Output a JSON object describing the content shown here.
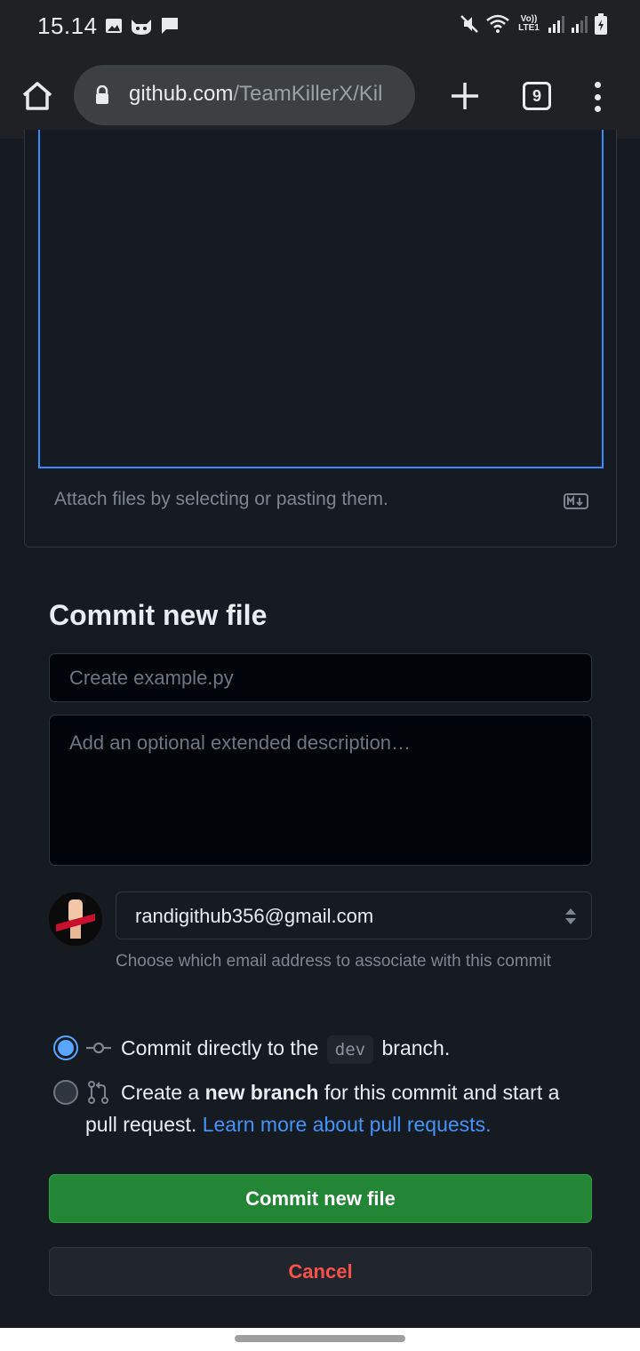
{
  "status_bar": {
    "time": "15.14",
    "lte_label": "Vo)) LTE1",
    "left_icons": [
      "gallery-icon",
      "cat-icon",
      "message-icon"
    ],
    "right_icons": [
      "mute-icon",
      "wifi-icon",
      "signal-icon",
      "signal-icon",
      "battery-icon"
    ]
  },
  "browser": {
    "url_host": "github.com",
    "url_path": "/TeamKillerX/Kil",
    "tab_count": "9"
  },
  "editor": {
    "attach_hint": "Attach files by selecting or pasting them."
  },
  "commit": {
    "title": "Commit new file",
    "summary_placeholder": "Create example.py",
    "description_placeholder": "Add an optional extended description…",
    "email": "randigithub356@gmail.com",
    "email_hint": "Choose which email address to associate with this commit",
    "option_direct_pre": "Commit directly to the",
    "branch": "dev",
    "option_direct_post": "branch.",
    "option_new_pre": "Create a",
    "option_new_bold": "new branch",
    "option_new_post": "for this commit and start a pull request.",
    "learn_more": "Learn more about pull requests.",
    "submit_label": "Commit new file",
    "cancel_label": "Cancel"
  },
  "colors": {
    "accent_blue": "#58a6ff",
    "commit_green": "#238636",
    "cancel_red": "#f85149",
    "background": "#161b22"
  }
}
